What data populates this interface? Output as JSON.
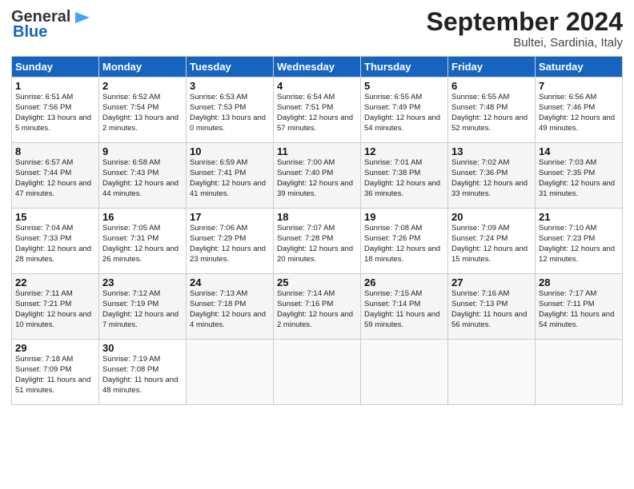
{
  "header": {
    "logo_general": "General",
    "logo_blue": "Blue",
    "month_title": "September 2024",
    "location": "Bultei, Sardinia, Italy"
  },
  "weekdays": [
    "Sunday",
    "Monday",
    "Tuesday",
    "Wednesday",
    "Thursday",
    "Friday",
    "Saturday"
  ],
  "weeks": [
    [
      {
        "day": "1",
        "sunrise": "6:51 AM",
        "sunset": "7:56 PM",
        "daylight": "13 hours and 5 minutes."
      },
      {
        "day": "2",
        "sunrise": "6:52 AM",
        "sunset": "7:54 PM",
        "daylight": "13 hours and 2 minutes."
      },
      {
        "day": "3",
        "sunrise": "6:53 AM",
        "sunset": "7:53 PM",
        "daylight": "13 hours and 0 minutes."
      },
      {
        "day": "4",
        "sunrise": "6:54 AM",
        "sunset": "7:51 PM",
        "daylight": "12 hours and 57 minutes."
      },
      {
        "day": "5",
        "sunrise": "6:55 AM",
        "sunset": "7:49 PM",
        "daylight": "12 hours and 54 minutes."
      },
      {
        "day": "6",
        "sunrise": "6:55 AM",
        "sunset": "7:48 PM",
        "daylight": "12 hours and 52 minutes."
      },
      {
        "day": "7",
        "sunrise": "6:56 AM",
        "sunset": "7:46 PM",
        "daylight": "12 hours and 49 minutes."
      }
    ],
    [
      {
        "day": "8",
        "sunrise": "6:57 AM",
        "sunset": "7:44 PM",
        "daylight": "12 hours and 47 minutes."
      },
      {
        "day": "9",
        "sunrise": "6:58 AM",
        "sunset": "7:43 PM",
        "daylight": "12 hours and 44 minutes."
      },
      {
        "day": "10",
        "sunrise": "6:59 AM",
        "sunset": "7:41 PM",
        "daylight": "12 hours and 41 minutes."
      },
      {
        "day": "11",
        "sunrise": "7:00 AM",
        "sunset": "7:40 PM",
        "daylight": "12 hours and 39 minutes."
      },
      {
        "day": "12",
        "sunrise": "7:01 AM",
        "sunset": "7:38 PM",
        "daylight": "12 hours and 36 minutes."
      },
      {
        "day": "13",
        "sunrise": "7:02 AM",
        "sunset": "7:36 PM",
        "daylight": "12 hours and 33 minutes."
      },
      {
        "day": "14",
        "sunrise": "7:03 AM",
        "sunset": "7:35 PM",
        "daylight": "12 hours and 31 minutes."
      }
    ],
    [
      {
        "day": "15",
        "sunrise": "7:04 AM",
        "sunset": "7:33 PM",
        "daylight": "12 hours and 28 minutes."
      },
      {
        "day": "16",
        "sunrise": "7:05 AM",
        "sunset": "7:31 PM",
        "daylight": "12 hours and 26 minutes."
      },
      {
        "day": "17",
        "sunrise": "7:06 AM",
        "sunset": "7:29 PM",
        "daylight": "12 hours and 23 minutes."
      },
      {
        "day": "18",
        "sunrise": "7:07 AM",
        "sunset": "7:28 PM",
        "daylight": "12 hours and 20 minutes."
      },
      {
        "day": "19",
        "sunrise": "7:08 AM",
        "sunset": "7:26 PM",
        "daylight": "12 hours and 18 minutes."
      },
      {
        "day": "20",
        "sunrise": "7:09 AM",
        "sunset": "7:24 PM",
        "daylight": "12 hours and 15 minutes."
      },
      {
        "day": "21",
        "sunrise": "7:10 AM",
        "sunset": "7:23 PM",
        "daylight": "12 hours and 12 minutes."
      }
    ],
    [
      {
        "day": "22",
        "sunrise": "7:11 AM",
        "sunset": "7:21 PM",
        "daylight": "12 hours and 10 minutes."
      },
      {
        "day": "23",
        "sunrise": "7:12 AM",
        "sunset": "7:19 PM",
        "daylight": "12 hours and 7 minutes."
      },
      {
        "day": "24",
        "sunrise": "7:13 AM",
        "sunset": "7:18 PM",
        "daylight": "12 hours and 4 minutes."
      },
      {
        "day": "25",
        "sunrise": "7:14 AM",
        "sunset": "7:16 PM",
        "daylight": "12 hours and 2 minutes."
      },
      {
        "day": "26",
        "sunrise": "7:15 AM",
        "sunset": "7:14 PM",
        "daylight": "11 hours and 59 minutes."
      },
      {
        "day": "27",
        "sunrise": "7:16 AM",
        "sunset": "7:13 PM",
        "daylight": "11 hours and 56 minutes."
      },
      {
        "day": "28",
        "sunrise": "7:17 AM",
        "sunset": "7:11 PM",
        "daylight": "11 hours and 54 minutes."
      }
    ],
    [
      {
        "day": "29",
        "sunrise": "7:18 AM",
        "sunset": "7:09 PM",
        "daylight": "11 hours and 51 minutes."
      },
      {
        "day": "30",
        "sunrise": "7:19 AM",
        "sunset": "7:08 PM",
        "daylight": "11 hours and 48 minutes."
      },
      null,
      null,
      null,
      null,
      null
    ]
  ]
}
